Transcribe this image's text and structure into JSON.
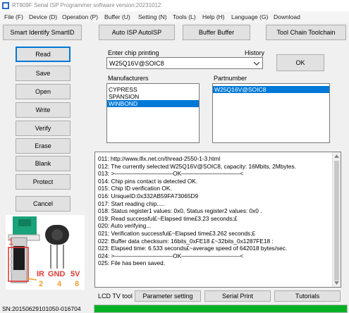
{
  "window": {
    "title": "RT809F Serial ISP Programmer software version:20231012",
    "menu": [
      "File (F)",
      "Device (D)",
      "Operation (P)",
      "Buffer (U)",
      "Setting (N)",
      "Tools (L)",
      "Help (H)",
      "Language (G)",
      "Download"
    ]
  },
  "toolbar": {
    "smart_identify": "Smart Identify SmartID",
    "auto_isp": "Auto ISP AutoISP",
    "buffer": "Buffer Buffer",
    "tool_chain": "Tool Chain Toolchain"
  },
  "actions": {
    "read": "Read",
    "save": "Save",
    "open": "Open",
    "write": "Write",
    "verify": "Verify",
    "erase": "Erase",
    "blank": "Blank",
    "protect": "Protect",
    "cancel": "Cancel"
  },
  "chip": {
    "enter_label": "Enter chip printing",
    "history_label": "History",
    "value": "W25Q16V@SOIC8",
    "ok_label": "OK"
  },
  "manufacturers": {
    "label": "Manufacturers",
    "items": [
      "CYPRESS",
      "SPANSION",
      "WINBOND"
    ],
    "selected": 2
  },
  "partnumber": {
    "label": "Partnumber",
    "items": [
      "W25Q16V@SOIC8"
    ],
    "selected": 0
  },
  "log": [
    "011:  http://www.ifix.net.cn/thread-2550-1-3.html",
    "012:  The currently selected:W25Q16V@SOIC8, capacity: 16Mbits, 2Mbytes.",
    "013:  >——————————OK——————————<",
    "014:  Chip pins contact is detected OK.",
    "015:  Chip ID verification OK.",
    "016:  UniqueID:0x332AB59FA73065D9",
    "017:  Start reading chip.....",
    "018:  Status register1 values: 0x0, Status register2 values: 0x0 .",
    "019:  Read successful£~Elapsed time£3.23 seconds;£",
    "020:  Auto verifying...",
    "021:  Verification successful£~Elapsed time£3.262 seconds;£",
    "022:  Buffer data checksum: 16bits_0xFE18 £~32bits_0x1287FE18 :",
    "023:  Elapsed time: 6.533 seconds£~average speed of 642018 bytes/sec.",
    "024:  >——————————OK——————————<",
    "025:  File has been saved."
  ],
  "pin_diagram": {
    "number_1": "1",
    "ir": "IR",
    "gnd": "GND",
    "v5": "5V",
    "n2": "2",
    "n4": "4",
    "n8": "8"
  },
  "bottom": {
    "lcd_tv_tool": "LCD TV tool",
    "parameter_setting": "Parameter setting",
    "serial_print": "Serial Print",
    "tutorials": "Tutorials"
  },
  "status": {
    "serial": "SN:20150629101050-016704",
    "progress": 1.0
  },
  "colors": {
    "accent": "#0078d7",
    "progress": "#06b025",
    "pin_red": "#e53935",
    "pin_orange": "#f0a030"
  }
}
